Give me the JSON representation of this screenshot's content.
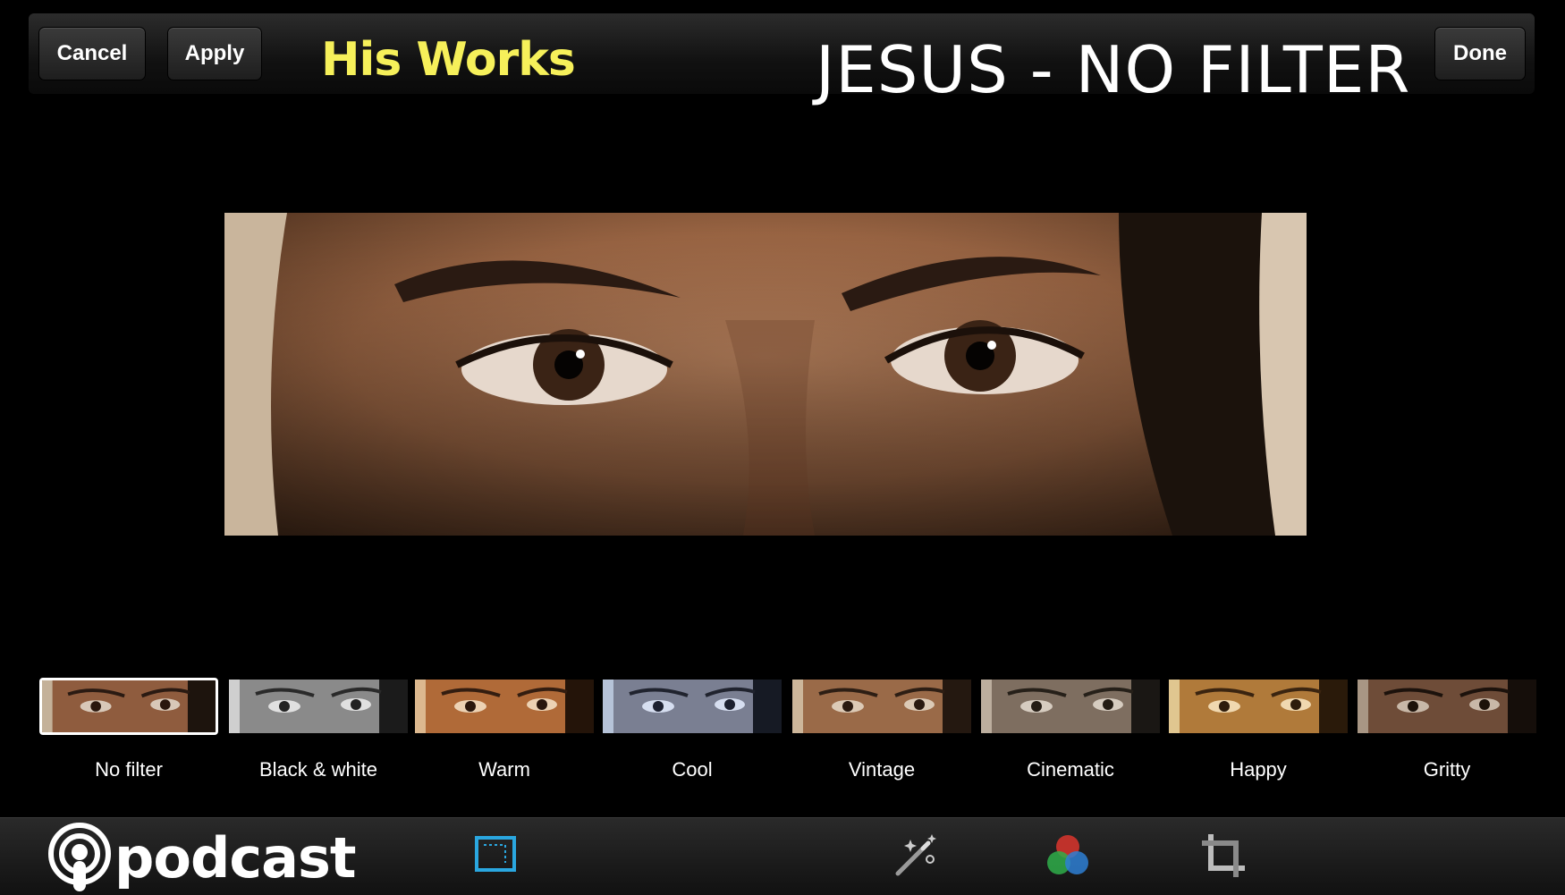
{
  "toolbar": {
    "cancel_label": "Cancel",
    "apply_label": "Apply",
    "done_label": "Done",
    "subtitle": "His Works",
    "title": "JESUS - NO FILTER"
  },
  "filters": [
    {
      "label": "No filter",
      "selected": true
    },
    {
      "label": "Black & white",
      "selected": false
    },
    {
      "label": "Warm",
      "selected": false
    },
    {
      "label": "Cool",
      "selected": false
    },
    {
      "label": "Vintage",
      "selected": false
    },
    {
      "label": "Cinematic",
      "selected": false
    },
    {
      "label": "Happy",
      "selected": false
    },
    {
      "label": "Gritty",
      "selected": false
    }
  ],
  "bottombar": {
    "logo_text": "podcast",
    "tools": [
      "crop-frame-icon",
      "magic-wand-icon",
      "color-circles-icon",
      "crop-icon"
    ]
  },
  "colors": {
    "subtitle": "#f6f05a",
    "accent_blue": "#2aa7e0"
  }
}
